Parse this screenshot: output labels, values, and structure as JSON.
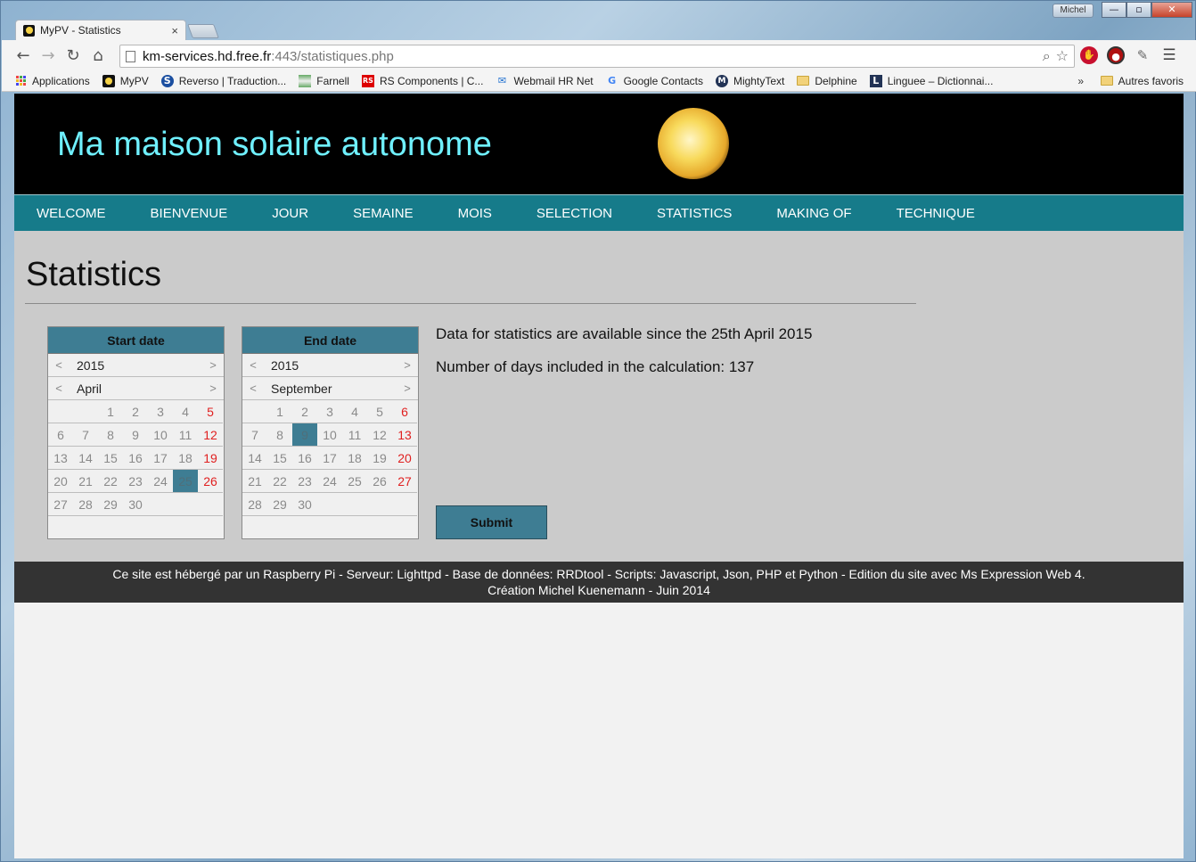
{
  "window": {
    "user": "Michel",
    "controls": {
      "minimize": "—",
      "maximize": "▫",
      "close": "✕"
    }
  },
  "tab": {
    "title": "MyPV - Statistics",
    "close": "×"
  },
  "toolbar": {
    "back": "←",
    "forward": "→",
    "reload": "↻",
    "home": "⌂",
    "url_host": "km-services.hd.free.fr",
    "url_rest": ":443/statistiques.php",
    "zoom_icon": "⌕",
    "star_icon": "☆"
  },
  "bookmarks": {
    "items": [
      {
        "label": "Applications",
        "icon": "apps-grid-icon"
      },
      {
        "label": "MyPV",
        "icon": "sun-icon"
      },
      {
        "label": "Reverso | Traduction...",
        "icon": "reverso-icon"
      },
      {
        "label": "Farnell",
        "icon": "farnell-icon"
      },
      {
        "label": "RS Components | C...",
        "icon": "rs-icon"
      },
      {
        "label": "Webmail HR Net",
        "icon": "mail-icon"
      },
      {
        "label": "Google Contacts",
        "icon": "google-icon"
      },
      {
        "label": "MightyText",
        "icon": "mightytext-icon"
      },
      {
        "label": "Delphine",
        "icon": "folder-icon"
      },
      {
        "label": "Linguee – Dictionnai...",
        "icon": "linguee-icon"
      }
    ],
    "more": "»",
    "other": "Autres favoris"
  },
  "site": {
    "title": "Ma maison solaire autonome",
    "nav": [
      "WELCOME",
      "BIENVENUE",
      "JOUR",
      "SEMAINE",
      "MOIS",
      "SELECTION",
      "STATISTICS",
      "MAKING OF",
      "TECHNIQUE"
    ]
  },
  "main": {
    "title": "Statistics",
    "start_cal": {
      "label": "Start date",
      "year": "2015",
      "month": "April",
      "prev": "<",
      "next": ">",
      "selected_day": 25,
      "weeks": [
        [
          "",
          "",
          "1",
          "2",
          "3",
          "4",
          "5"
        ],
        [
          "6",
          "7",
          "8",
          "9",
          "10",
          "11",
          "12"
        ],
        [
          "13",
          "14",
          "15",
          "16",
          "17",
          "18",
          "19"
        ],
        [
          "20",
          "21",
          "22",
          "23",
          "24",
          "25",
          "26"
        ],
        [
          "27",
          "28",
          "29",
          "30",
          "",
          "",
          ""
        ]
      ]
    },
    "end_cal": {
      "label": "End date",
      "year": "2015",
      "month": "September",
      "prev": "<",
      "next": ">",
      "selected_day": 9,
      "weeks": [
        [
          "",
          "1",
          "2",
          "3",
          "4",
          "5",
          "6"
        ],
        [
          "7",
          "8",
          "9",
          "10",
          "11",
          "12",
          "13"
        ],
        [
          "14",
          "15",
          "16",
          "17",
          "18",
          "19",
          "20"
        ],
        [
          "21",
          "22",
          "23",
          "24",
          "25",
          "26",
          "27"
        ],
        [
          "28",
          "29",
          "30",
          "",
          "",
          "",
          ""
        ]
      ]
    },
    "info_available": "Data for statistics are available since the 25th April 2015",
    "info_days": "Number of days included in the calculation: 137",
    "submit_label": "Submit"
  },
  "footer": {
    "line1": "Ce site est hébergé par un Raspberry Pi - Serveur: Lighttpd - Base de données: RRDtool - Scripts: Javascript, Json, PHP et Python - Edition du site avec Ms Expression Web 4.",
    "line2": "Création Michel Kuenemann - Juin 2014"
  },
  "colors": {
    "nav_bg": "#167b8a",
    "calendar_header": "#3e7d93",
    "title_cyan": "#6ff0ff",
    "weekend_red": "#e02020"
  }
}
